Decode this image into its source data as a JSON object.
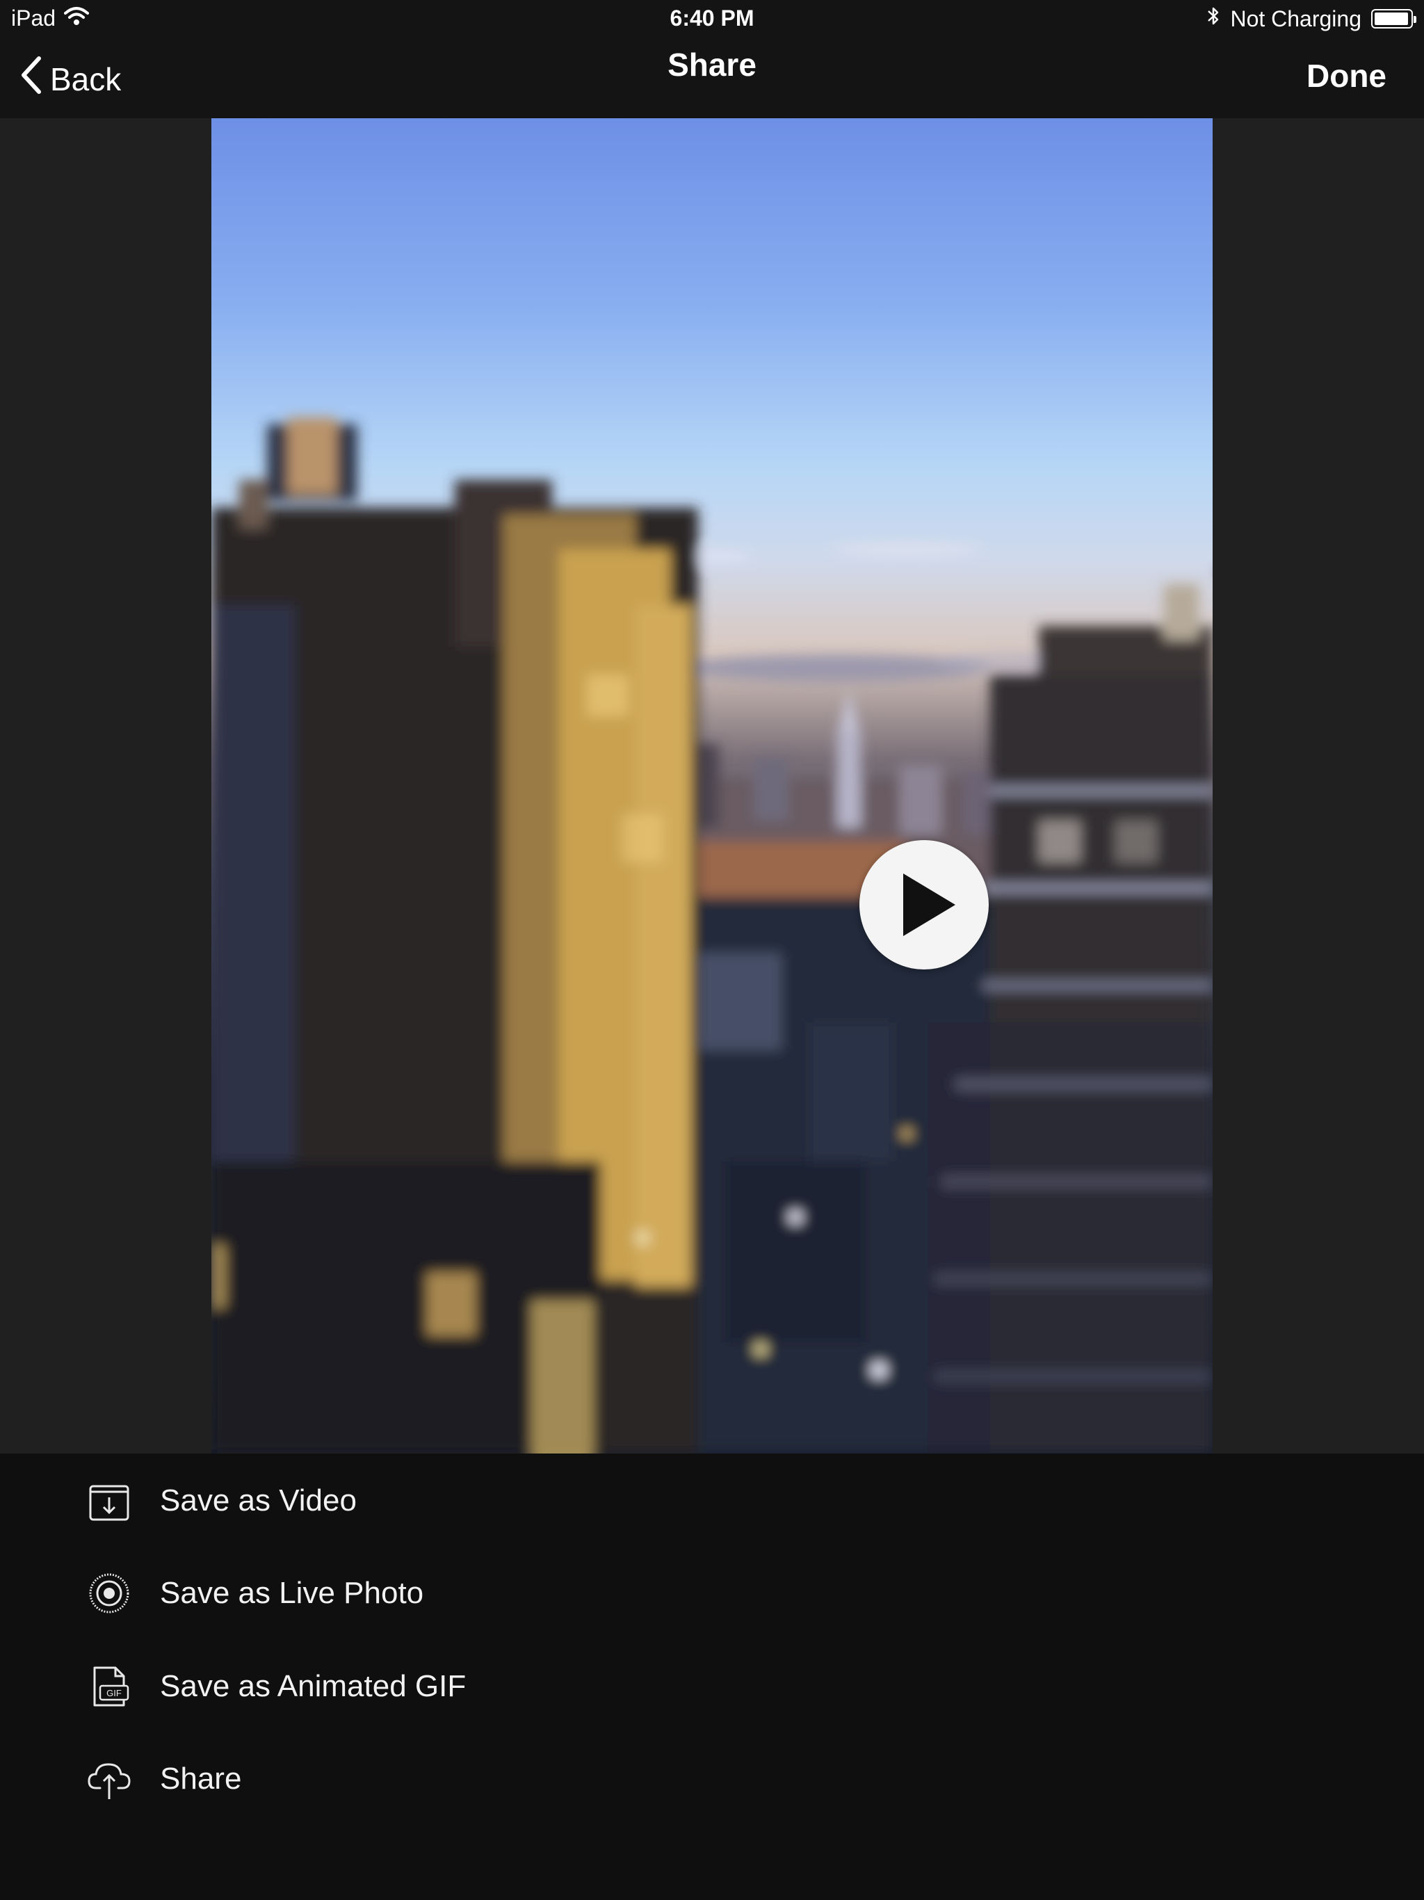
{
  "status_bar": {
    "device": "iPad",
    "time": "6:40 PM",
    "battery_status": "Not Charging",
    "icons": [
      "wifi-icon",
      "bluetooth-icon",
      "battery-icon"
    ]
  },
  "nav": {
    "back_label": "Back",
    "title": "Share",
    "done_label": "Done"
  },
  "preview": {
    "play_icon": "play-icon"
  },
  "actions": [
    {
      "label": "Save as Video",
      "icon": "download-box-icon"
    },
    {
      "label": "Save as Live Photo",
      "icon": "live-photo-icon"
    },
    {
      "label": "Save as Animated GIF",
      "icon": "gif-file-icon"
    },
    {
      "label": "Share",
      "icon": "cloud-upload-icon"
    }
  ],
  "colors": {
    "background": "#0f0f10",
    "content_background": "#202021",
    "text": "#ffffff"
  }
}
